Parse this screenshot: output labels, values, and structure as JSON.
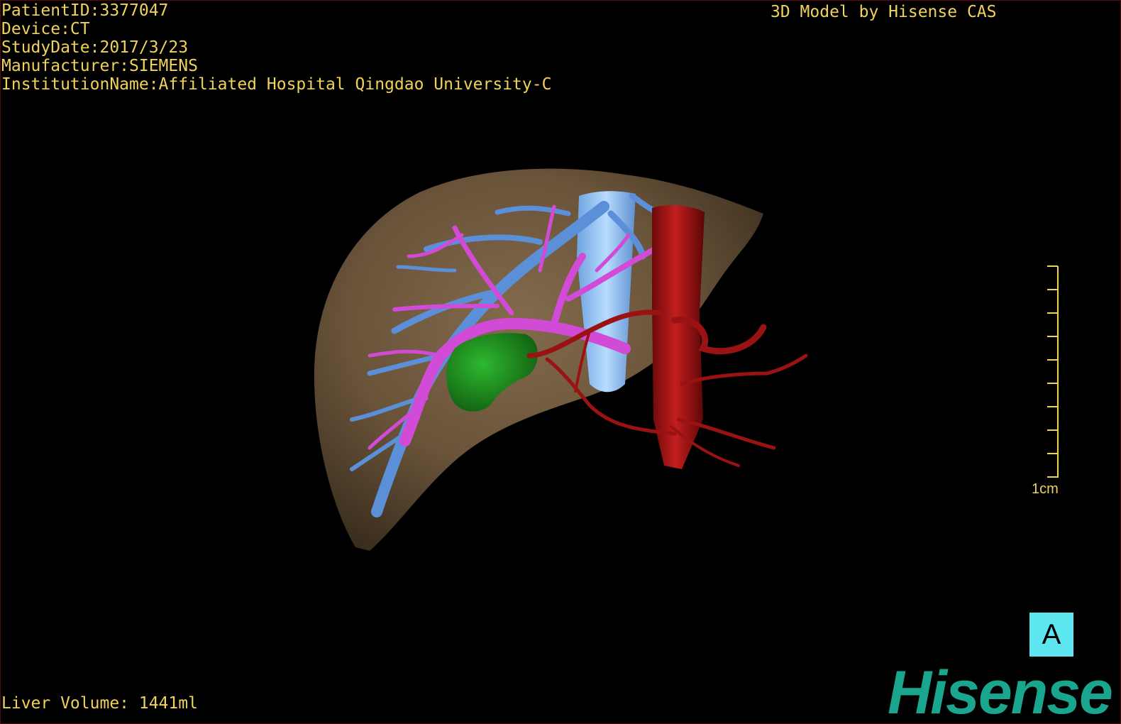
{
  "header": {
    "patient_id": "PatientID:3377047",
    "device": "Device:CT",
    "study_date": "StudyDate:2017/3/23",
    "manufacturer": "Manufacturer:SIEMENS",
    "institution": "InstitutionName:Affiliated Hospital Qingdao University-C",
    "brand_credit": "3D Model by Hisense CAS"
  },
  "footer": {
    "liver_volume": "Liver Volume: 1441ml"
  },
  "scale": {
    "label": "1cm"
  },
  "view": {
    "badge": "A"
  },
  "logo": {
    "text": "Hisense"
  },
  "colors": {
    "overlay_text": "#f0d25a",
    "liver": "#7a6244",
    "portal_vein": "#5b8fd8",
    "hepatic_vein": "#d24bd6",
    "ivc": "#8ec6ff",
    "aorta": "#a81616",
    "tumor": "#1f8f1f",
    "badge_bg": "#5ee6f0",
    "logo": "#1aa58f"
  },
  "structures": [
    "liver",
    "portal-vein",
    "hepatic-vein",
    "inferior-vena-cava",
    "aorta",
    "hepatic-artery",
    "tumor"
  ]
}
